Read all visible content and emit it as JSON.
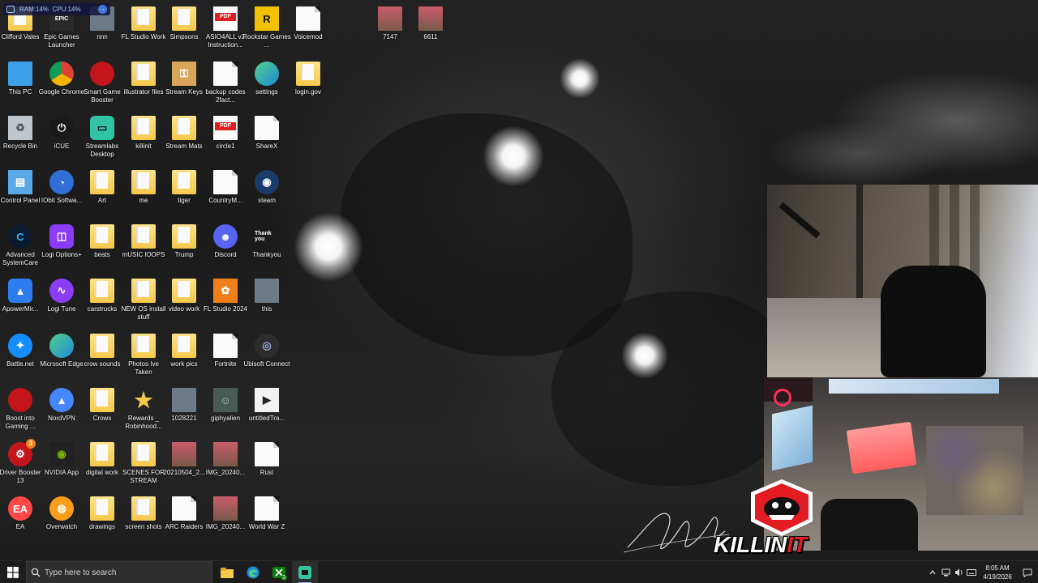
{
  "perf_overlay": {
    "ram": "RAM:14%",
    "cpu": "CPU:14%"
  },
  "desktop_icons": [
    {
      "label": "Clifford Vales",
      "icon": "folder-icon"
    },
    {
      "label": "Epic Games Launcher",
      "icon": "epic-games-icon"
    },
    {
      "label": "nnn",
      "icon": "image-icon"
    },
    {
      "label": "FL Studio Work",
      "icon": "folder-icon"
    },
    {
      "label": "Simpsons",
      "icon": "folder-icon"
    },
    {
      "label": "ASIO4ALL v2 Instruction...",
      "icon": "pdf-icon"
    },
    {
      "label": "Rockstar Games ...",
      "icon": "rockstar-icon"
    },
    {
      "label": "Voicemod",
      "icon": "document-icon"
    },
    {
      "label": "7147",
      "icon": "photo-icon"
    },
    {
      "label": "6611",
      "icon": "photo-icon"
    },
    {
      "label": "This PC",
      "icon": "computer-icon"
    },
    {
      "label": "Google Chrome",
      "icon": "chrome-icon"
    },
    {
      "label": "Smart Game Booster",
      "icon": "game-booster-icon"
    },
    {
      "label": "illustrator files",
      "icon": "folder-icon"
    },
    {
      "label": "Stream Keys",
      "icon": "key-icon"
    },
    {
      "label": "backup codes 2fact...",
      "icon": "document-icon"
    },
    {
      "label": "settings",
      "icon": "edge-icon"
    },
    {
      "label": "login.gov",
      "icon": "folder-icon"
    },
    {
      "label": "Recycle Bin",
      "icon": "recycle-bin-icon"
    },
    {
      "label": "iCUE",
      "icon": "icue-icon"
    },
    {
      "label": "Streamlabs Desktop",
      "icon": "streamlabs-icon"
    },
    {
      "label": "killinit",
      "icon": "folder-icon"
    },
    {
      "label": "Stream Mats",
      "icon": "folder-icon"
    },
    {
      "label": "circle1",
      "icon": "pdf-icon"
    },
    {
      "label": "ShareX",
      "icon": "document-icon"
    },
    {
      "label": "Control Panel",
      "icon": "control-panel-icon"
    },
    {
      "label": "IObit Softwa...",
      "icon": "iobit-icon"
    },
    {
      "label": "Art",
      "icon": "folder-icon"
    },
    {
      "label": "me",
      "icon": "folder-icon"
    },
    {
      "label": "tiger",
      "icon": "folder-icon"
    },
    {
      "label": "CountryM...",
      "icon": "document-icon"
    },
    {
      "label": "steam",
      "icon": "steam-icon"
    },
    {
      "label": "Advanced SystemCare",
      "icon": "advanced-systemcare-icon"
    },
    {
      "label": "Logi Options+",
      "icon": "logi-options-icon"
    },
    {
      "label": "beats",
      "icon": "folder-icon"
    },
    {
      "label": "mUSIC lOOPS",
      "icon": "folder-icon"
    },
    {
      "label": "Trump",
      "icon": "folder-icon"
    },
    {
      "label": "Discord",
      "icon": "discord-icon"
    },
    {
      "label": "Thankyou",
      "icon": "thankyou-image-icon"
    },
    {
      "label": "ApowerMir...",
      "icon": "apowermirror-icon"
    },
    {
      "label": "Logi Tune",
      "icon": "logi-tune-icon"
    },
    {
      "label": "carstrucks",
      "icon": "folder-icon"
    },
    {
      "label": "NEW OS install stuff",
      "icon": "folder-icon"
    },
    {
      "label": "video work",
      "icon": "folder-icon"
    },
    {
      "label": "FL Studio 2024",
      "icon": "fl-studio-icon"
    },
    {
      "label": "this",
      "icon": "image-icon"
    },
    {
      "label": "Battle.net",
      "icon": "battlenet-icon"
    },
    {
      "label": "Microsoft Edge",
      "icon": "edge-icon"
    },
    {
      "label": "crow sounds",
      "icon": "folder-icon"
    },
    {
      "label": "Photos Ive Taken",
      "icon": "folder-icon"
    },
    {
      "label": "work pics",
      "icon": "folder-icon"
    },
    {
      "label": "Fortnite",
      "icon": "document-icon"
    },
    {
      "label": "Ubisoft Connect",
      "icon": "ubisoft-icon"
    },
    {
      "label": "Boost into Gaming ...",
      "icon": "game-booster-icon"
    },
    {
      "label": "NordVPN",
      "icon": "nordvpn-icon"
    },
    {
      "label": "Crows",
      "icon": "folder-icon"
    },
    {
      "label": "Rewards _ Robinhood...",
      "icon": "star-icon"
    },
    {
      "label": "1028221",
      "icon": "image-icon"
    },
    {
      "label": "giphyalien",
      "icon": "alien-image-icon"
    },
    {
      "label": "untitledTra...",
      "icon": "media-icon"
    },
    {
      "label": "Driver Booster 13",
      "icon": "driver-booster-icon"
    },
    {
      "label": "NVIDIA App",
      "icon": "nvidia-icon"
    },
    {
      "label": "digital work",
      "icon": "folder-icon"
    },
    {
      "label": "SCENES FOR STREAM",
      "icon": "folder-icon"
    },
    {
      "label": "20210504_2...",
      "icon": "photo-icon"
    },
    {
      "label": "IMG_20240...",
      "icon": "photo-icon"
    },
    {
      "label": "Rust",
      "icon": "document-icon"
    },
    {
      "label": "EA",
      "icon": "ea-icon"
    },
    {
      "label": "Overwatch",
      "icon": "overwatch-icon"
    },
    {
      "label": "drawings",
      "icon": "folder-icon"
    },
    {
      "label": "screen shots",
      "icon": "folder-icon"
    },
    {
      "label": "ARC Raiders",
      "icon": "document-icon"
    },
    {
      "label": "IMG_20240...",
      "icon": "photo-icon"
    },
    {
      "label": "World War Z",
      "icon": "document-icon"
    }
  ],
  "badges": {
    "driver_booster": "3",
    "xbox": "3"
  },
  "overlay_logo": {
    "text_main": "KILLIN",
    "text_accent": "IT"
  },
  "taskbar": {
    "search_placeholder": "Type here to search",
    "apps": [
      "file-explorer-icon",
      "edge-icon",
      "xbox-icon",
      "streamlabs-icon"
    ],
    "clock_time": "8:05 AM",
    "clock_date": "4/19/2026"
  },
  "colors": {
    "accent_red": "#e31b23",
    "taskbar": "#1c1c1c",
    "folder": "#f5c94c"
  }
}
